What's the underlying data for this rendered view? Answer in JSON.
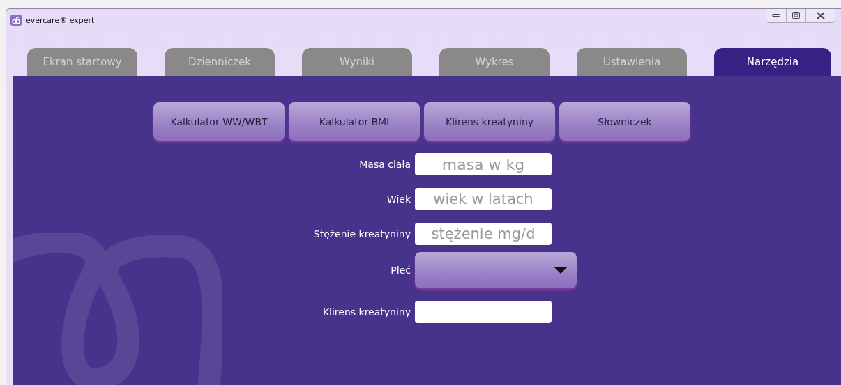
{
  "window": {
    "title": "evercare® expert"
  },
  "tabs": [
    {
      "label": "Ekran startowy",
      "selected": false
    },
    {
      "label": "Dzienniczek",
      "selected": false
    },
    {
      "label": "Wyniki",
      "selected": false
    },
    {
      "label": "Wykres",
      "selected": false
    },
    {
      "label": "Ustawienia",
      "selected": false
    },
    {
      "label": "Narzędzia",
      "selected": true
    }
  ],
  "tool_buttons": [
    "Kalkulator WW/WBT",
    "Kalkulator BMI",
    "Klirens kreatyniny",
    "Słowniczek"
  ],
  "form": [
    {
      "label": "Masa ciała",
      "kind": "input",
      "placeholder": "masa w kg"
    },
    {
      "label": "Wiek",
      "kind": "input",
      "placeholder": "wiek w latach"
    },
    {
      "label": "Stężenie kreatyniny",
      "kind": "input",
      "placeholder": "stężenie mg/d"
    },
    {
      "label": "Płeć",
      "kind": "select"
    },
    {
      "label": "Klirens kreatyniny",
      "kind": "input"
    }
  ]
}
